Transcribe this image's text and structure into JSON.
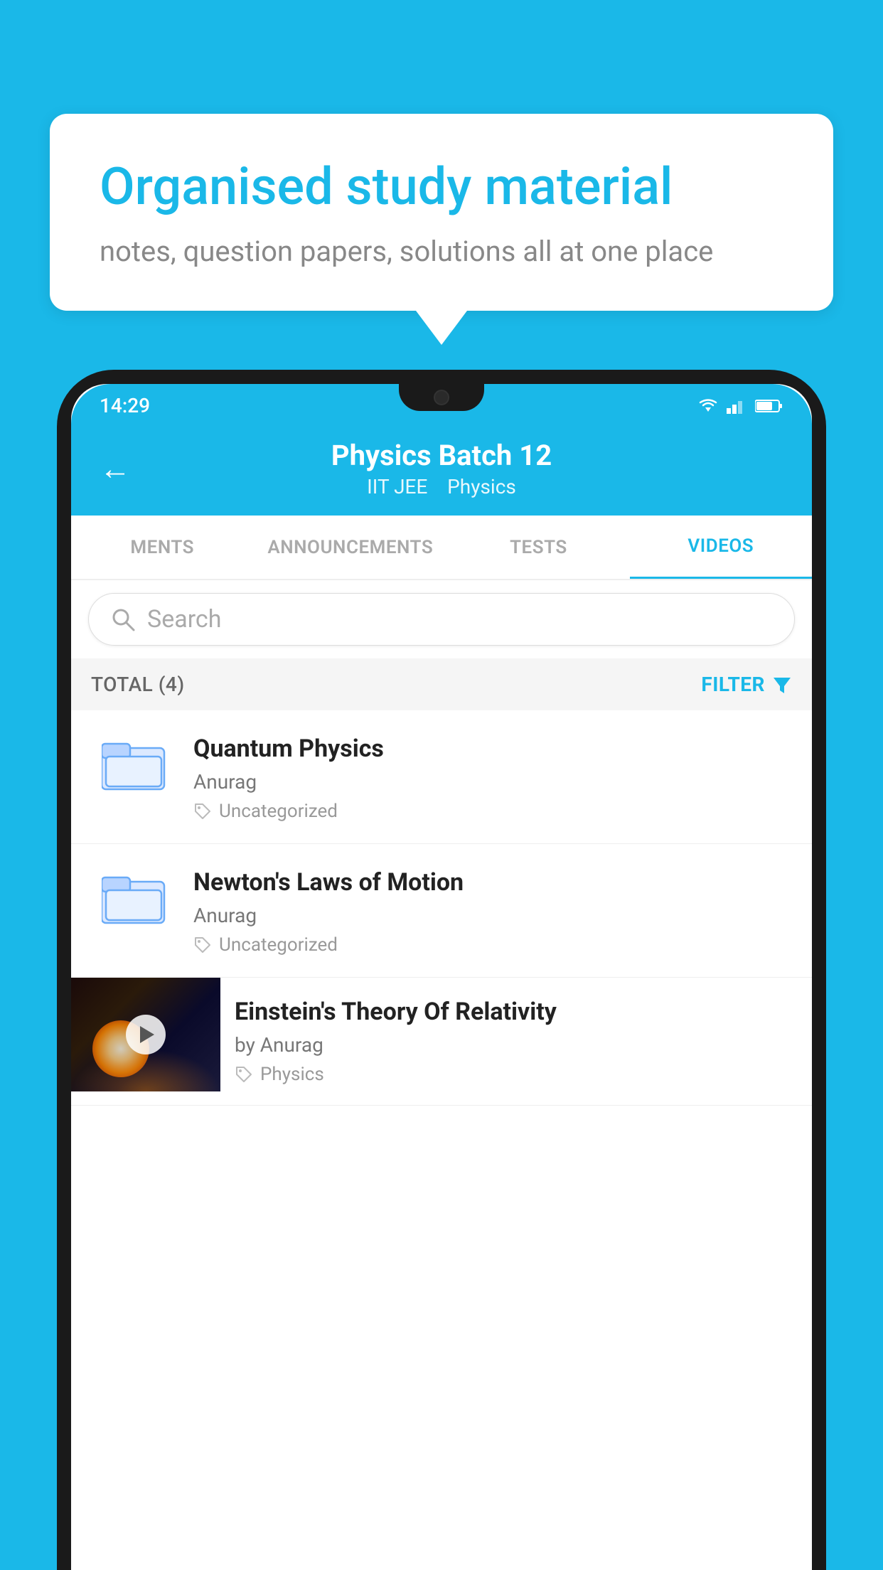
{
  "background_color": "#1ab8e8",
  "speech_bubble": {
    "title": "Organised study material",
    "subtitle": "notes, question papers, solutions all at one place"
  },
  "phone": {
    "status_bar": {
      "time": "14:29"
    },
    "header": {
      "title": "Physics Batch 12",
      "subtitle_part1": "IIT JEE",
      "subtitle_part2": "Physics",
      "back_label": "←"
    },
    "tabs": [
      {
        "label": "MENTS",
        "active": false
      },
      {
        "label": "ANNOUNCEMENTS",
        "active": false
      },
      {
        "label": "TESTS",
        "active": false
      },
      {
        "label": "VIDEOS",
        "active": true
      }
    ],
    "search": {
      "placeholder": "Search"
    },
    "filter_bar": {
      "total_label": "TOTAL (4)",
      "filter_label": "FILTER"
    },
    "videos": [
      {
        "id": 1,
        "title": "Quantum Physics",
        "author": "Anurag",
        "tag": "Uncategorized",
        "has_thumbnail": false
      },
      {
        "id": 2,
        "title": "Newton's Laws of Motion",
        "author": "Anurag",
        "tag": "Uncategorized",
        "has_thumbnail": false
      },
      {
        "id": 3,
        "title": "Einstein's Theory Of Relativity",
        "author": "by Anurag",
        "tag": "Physics",
        "has_thumbnail": true
      }
    ]
  }
}
